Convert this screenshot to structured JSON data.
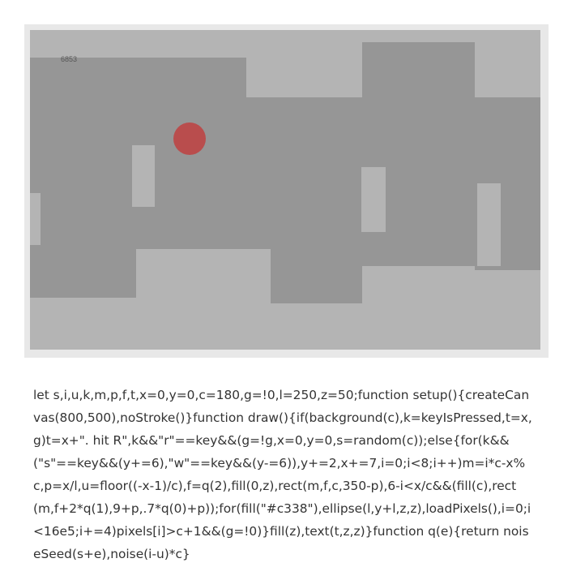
{
  "game": {
    "score_text": "6853",
    "colors": {
      "background": "#b4b4b4",
      "terrain": "#969696",
      "player": "#c33838",
      "frame": "#e8e8e8"
    }
  },
  "source_code": "let s,i,u,k,m,p,f,t,x=0,y=0,c=180,g=!0,l=250,z=50;function setup(){createCanvas(800,500),noStroke()}function draw(){if(background(c),k=keyIsPressed,t=x,g)t=x+\". hit R\",k&&\"r\"==key&&(g=!g,x=0,y=0,s=random(c));else{for(k&&(\"s\"==key&&(y+=6),\"w\"==key&&(y-=6)),y+=2,x+=7,i=0;i<8;i++)m=i*c-x%c,p=x/l,u=floor((-x-1)/c),f=q(2),fill(0,z),rect(m,f,c,350-p),6-i<x/c&&(fill(c),rect(m,f+2*q(1),9+p,.7*q(0)+p));for(fill(\"#c338\"),ellipse(l,y+l,z,z),loadPixels(),i=0;i<16e5;i+=4)pixels[i]>c+1&&(g=!0)}fill(z),text(t,z,z)}function q(e){return noiseSeed(s+e),noise(i-u)*c}"
}
